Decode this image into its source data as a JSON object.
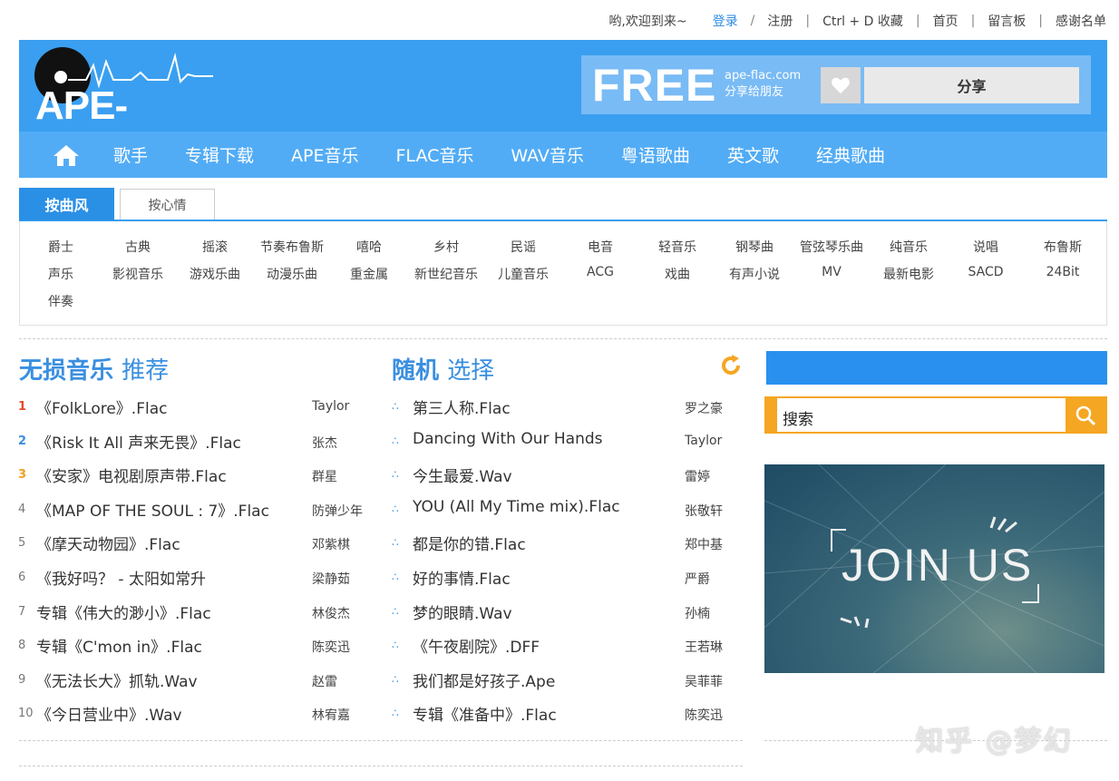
{
  "toplinks": {
    "welcome": "哟,欢迎到来~",
    "login": "登录",
    "register": "注册",
    "bookmark": "Ctrl + D 收藏",
    "home": "首页",
    "guestbook": "留言板",
    "thanks": "感谢名单",
    "slash": "/",
    "pipe": "|"
  },
  "header": {
    "logo_text": "APE-FLAC",
    "free": "FREE",
    "site": "ape-flac.com",
    "share_tip": "分享给朋友",
    "share_button": "分享"
  },
  "nav": {
    "items": [
      "歌手",
      "专辑下载",
      "APE音乐",
      "FLAC音乐",
      "WAV音乐",
      "粤语歌曲",
      "英文歌",
      "经典歌曲"
    ]
  },
  "tabs": {
    "style": "按曲风",
    "mood": "按心情"
  },
  "genres": [
    "爵士",
    "古典",
    "摇滚",
    "节奏布鲁斯",
    "嘻哈",
    "乡村",
    "民谣",
    "电音",
    "轻音乐",
    "钢琴曲",
    "管弦琴乐曲",
    "纯音乐",
    "说唱",
    "布鲁斯",
    "声乐",
    "影视音乐",
    "游戏乐曲",
    "动漫乐曲",
    "重金属",
    "新世纪音乐",
    "儿童音乐",
    "ACG",
    "戏曲",
    "有声小说",
    "MV",
    "最新电影",
    "SACD",
    "24Bit",
    "伴奏"
  ],
  "recommend": {
    "title_bold": "无损音乐",
    "title_light": "推荐",
    "items": [
      {
        "num": "1",
        "title": "《FolkLore》.Flac",
        "artist": "Taylor"
      },
      {
        "num": "2",
        "title": "《Risk It All 声来无畏》.Flac",
        "artist": "张杰"
      },
      {
        "num": "3",
        "title": "《安家》电视剧原声带.Flac",
        "artist": "群星"
      },
      {
        "num": "4",
        "title": "《MAP OF THE SOUL : 7》.Flac",
        "artist": "防弹少年"
      },
      {
        "num": "5",
        "title": "《摩天动物园》.Flac",
        "artist": "邓紫棋"
      },
      {
        "num": "6",
        "title": "《我好吗？ - 太阳如常升",
        "artist": "梁静茹"
      },
      {
        "num": "7",
        "title": "专辑《伟大的渺小》.Flac",
        "artist": "林俊杰"
      },
      {
        "num": "8",
        "title": "专辑《C'mon in》.Flac",
        "artist": "陈奕迅"
      },
      {
        "num": "9",
        "title": "《无法长大》抓轨.Wav",
        "artist": "赵雷"
      },
      {
        "num": "10",
        "title": "《今日营业中》.Wav",
        "artist": "林宥嘉"
      }
    ]
  },
  "random": {
    "title_bold": "随机",
    "title_light": "选择",
    "bullet": "∴",
    "items": [
      {
        "title": "第三人称.Flac",
        "artist": "罗之豪"
      },
      {
        "title": "Dancing With Our Hands",
        "artist": "Taylor"
      },
      {
        "title": "今生最爱.Wav",
        "artist": "雷婷"
      },
      {
        "title": "YOU (All My Time mix).Flac",
        "artist": "张敬轩"
      },
      {
        "title": "都是你的错.Flac",
        "artist": "郑中基"
      },
      {
        "title": "好的事情.Flac",
        "artist": "严爵"
      },
      {
        "title": "梦的眼睛.Wav",
        "artist": "孙楠"
      },
      {
        "title": "《午夜剧院》.DFF",
        "artist": "王若琳"
      },
      {
        "title": "我们都是好孩子.Ape",
        "artist": "吴菲菲"
      },
      {
        "title": "专辑《准备中》.Flac",
        "artist": "陈奕迅"
      }
    ]
  },
  "search": {
    "placeholder": "搜索"
  },
  "banner": {
    "text": "JOIN US"
  },
  "watermark": "知乎 @梦幻",
  "colors": {
    "brand_blue": "#3a9ff0",
    "nav_blue": "#52acf5",
    "accent_orange": "#f5a623"
  }
}
